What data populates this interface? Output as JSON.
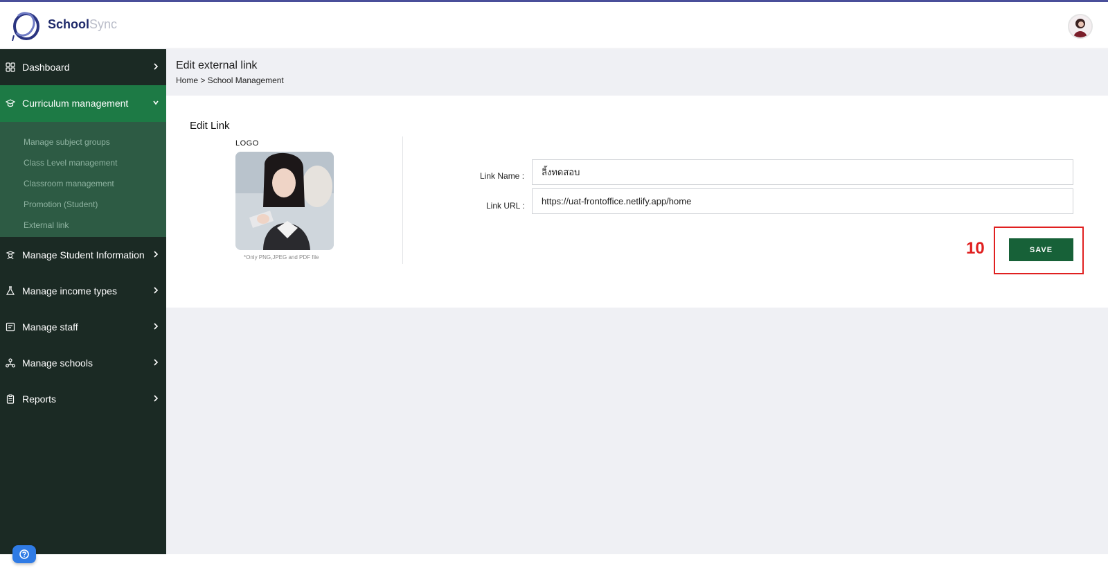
{
  "header": {
    "brand_primary": "School",
    "brand_secondary": "Sync"
  },
  "sidebar": {
    "items": [
      {
        "label": "Dashboard",
        "icon": "grid-icon"
      },
      {
        "label": "Curriculum management",
        "icon": "graduation-cap-icon",
        "expanded": true
      },
      {
        "label": "Manage Student Information",
        "icon": "student-icon"
      },
      {
        "label": "Manage income types",
        "icon": "flask-icon"
      },
      {
        "label": "Manage staff",
        "icon": "staff-board-icon"
      },
      {
        "label": "Manage schools",
        "icon": "school-network-icon"
      },
      {
        "label": "Reports",
        "icon": "clipboard-icon"
      }
    ],
    "submenu": [
      "Manage subject groups",
      "Class Level management",
      "Classroom management",
      "Promotion (Student)",
      "External link"
    ]
  },
  "page": {
    "title": "Edit external link",
    "breadcrumb": "Home > School Management"
  },
  "form": {
    "card_title": "Edit Link",
    "logo_label": "LOGO",
    "logo_hint": "*Only PNG,JPEG and PDF file",
    "link_name_label": "Link Name :",
    "link_name_value": "ลิ้งทดสอบ",
    "link_url_label": "Link URL :",
    "link_url_value": "https://uat-frontoffice.netlify.app/home",
    "save_label": "SAVE"
  },
  "annotation": {
    "step_number": "10",
    "color": "#e02020"
  },
  "colors": {
    "sidebar_bg": "#1b2a24",
    "active_item": "#1d7a45",
    "submenu_bg": "#2d5b44",
    "save_button": "#176138",
    "help_button": "#2f7be5"
  }
}
